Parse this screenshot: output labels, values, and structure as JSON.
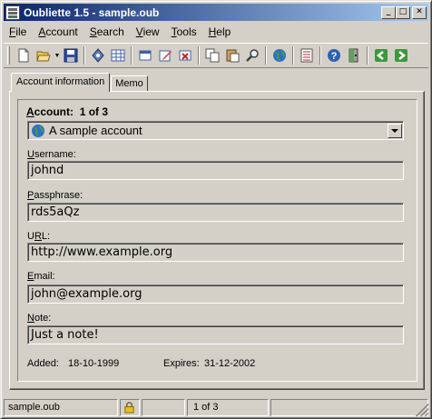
{
  "window": {
    "title": "Oubliette 1.5 - sample.oub",
    "min_symbol": "_",
    "max_symbol": "□",
    "close_symbol": "✕"
  },
  "menu": [
    {
      "pre": "",
      "acc": "F",
      "post": "ile"
    },
    {
      "pre": "",
      "acc": "A",
      "post": "ccount"
    },
    {
      "pre": "",
      "acc": "S",
      "post": "earch"
    },
    {
      "pre": "",
      "acc": "V",
      "post": "iew"
    },
    {
      "pre": "",
      "acc": "T",
      "post": "ools"
    },
    {
      "pre": "",
      "acc": "H",
      "post": "elp"
    }
  ],
  "toolbar": {
    "buttons": [
      "new-file-icon",
      "open-folder-icon",
      "save-icon",
      "properties-icon",
      "grid-icon",
      "folder-icon",
      "edit-icon",
      "delete-icon",
      "copy-icon",
      "paste-icon",
      "find-icon",
      "globe-icon",
      "list-icon",
      "help-icon",
      "exit-icon",
      "back-arrow-icon",
      "forward-arrow-icon"
    ],
    "accent_green": "#3a9a3a",
    "accent_blue": "#2a5ab0"
  },
  "tabs": {
    "account_info": "Account information",
    "memo": "Memo"
  },
  "account": {
    "label_acc": "A",
    "label_rest": "ccount:",
    "position": "1 of 3",
    "selected": "A sample account"
  },
  "fields": {
    "username": {
      "pre": "",
      "acc": "U",
      "post": "sername:",
      "value": "johnd"
    },
    "passphrase": {
      "pre": "",
      "acc": "P",
      "post": "assphrase:",
      "value": "rds5aQz"
    },
    "url": {
      "pre": "U",
      "acc": "R",
      "post": "L:",
      "value": "http://www.example.org"
    },
    "email": {
      "pre": "",
      "acc": "E",
      "post": "mail:",
      "value": "john@example.org"
    },
    "note": {
      "pre": "",
      "acc": "N",
      "post": "ote:",
      "value": "Just a note!"
    }
  },
  "dates": {
    "added_label": "Added:",
    "added_value": "18-10-1999",
    "expires_label": "Expires:",
    "expires_value": "31-12-2002"
  },
  "status": {
    "file": "sample.oub",
    "position": "1 of 3"
  }
}
